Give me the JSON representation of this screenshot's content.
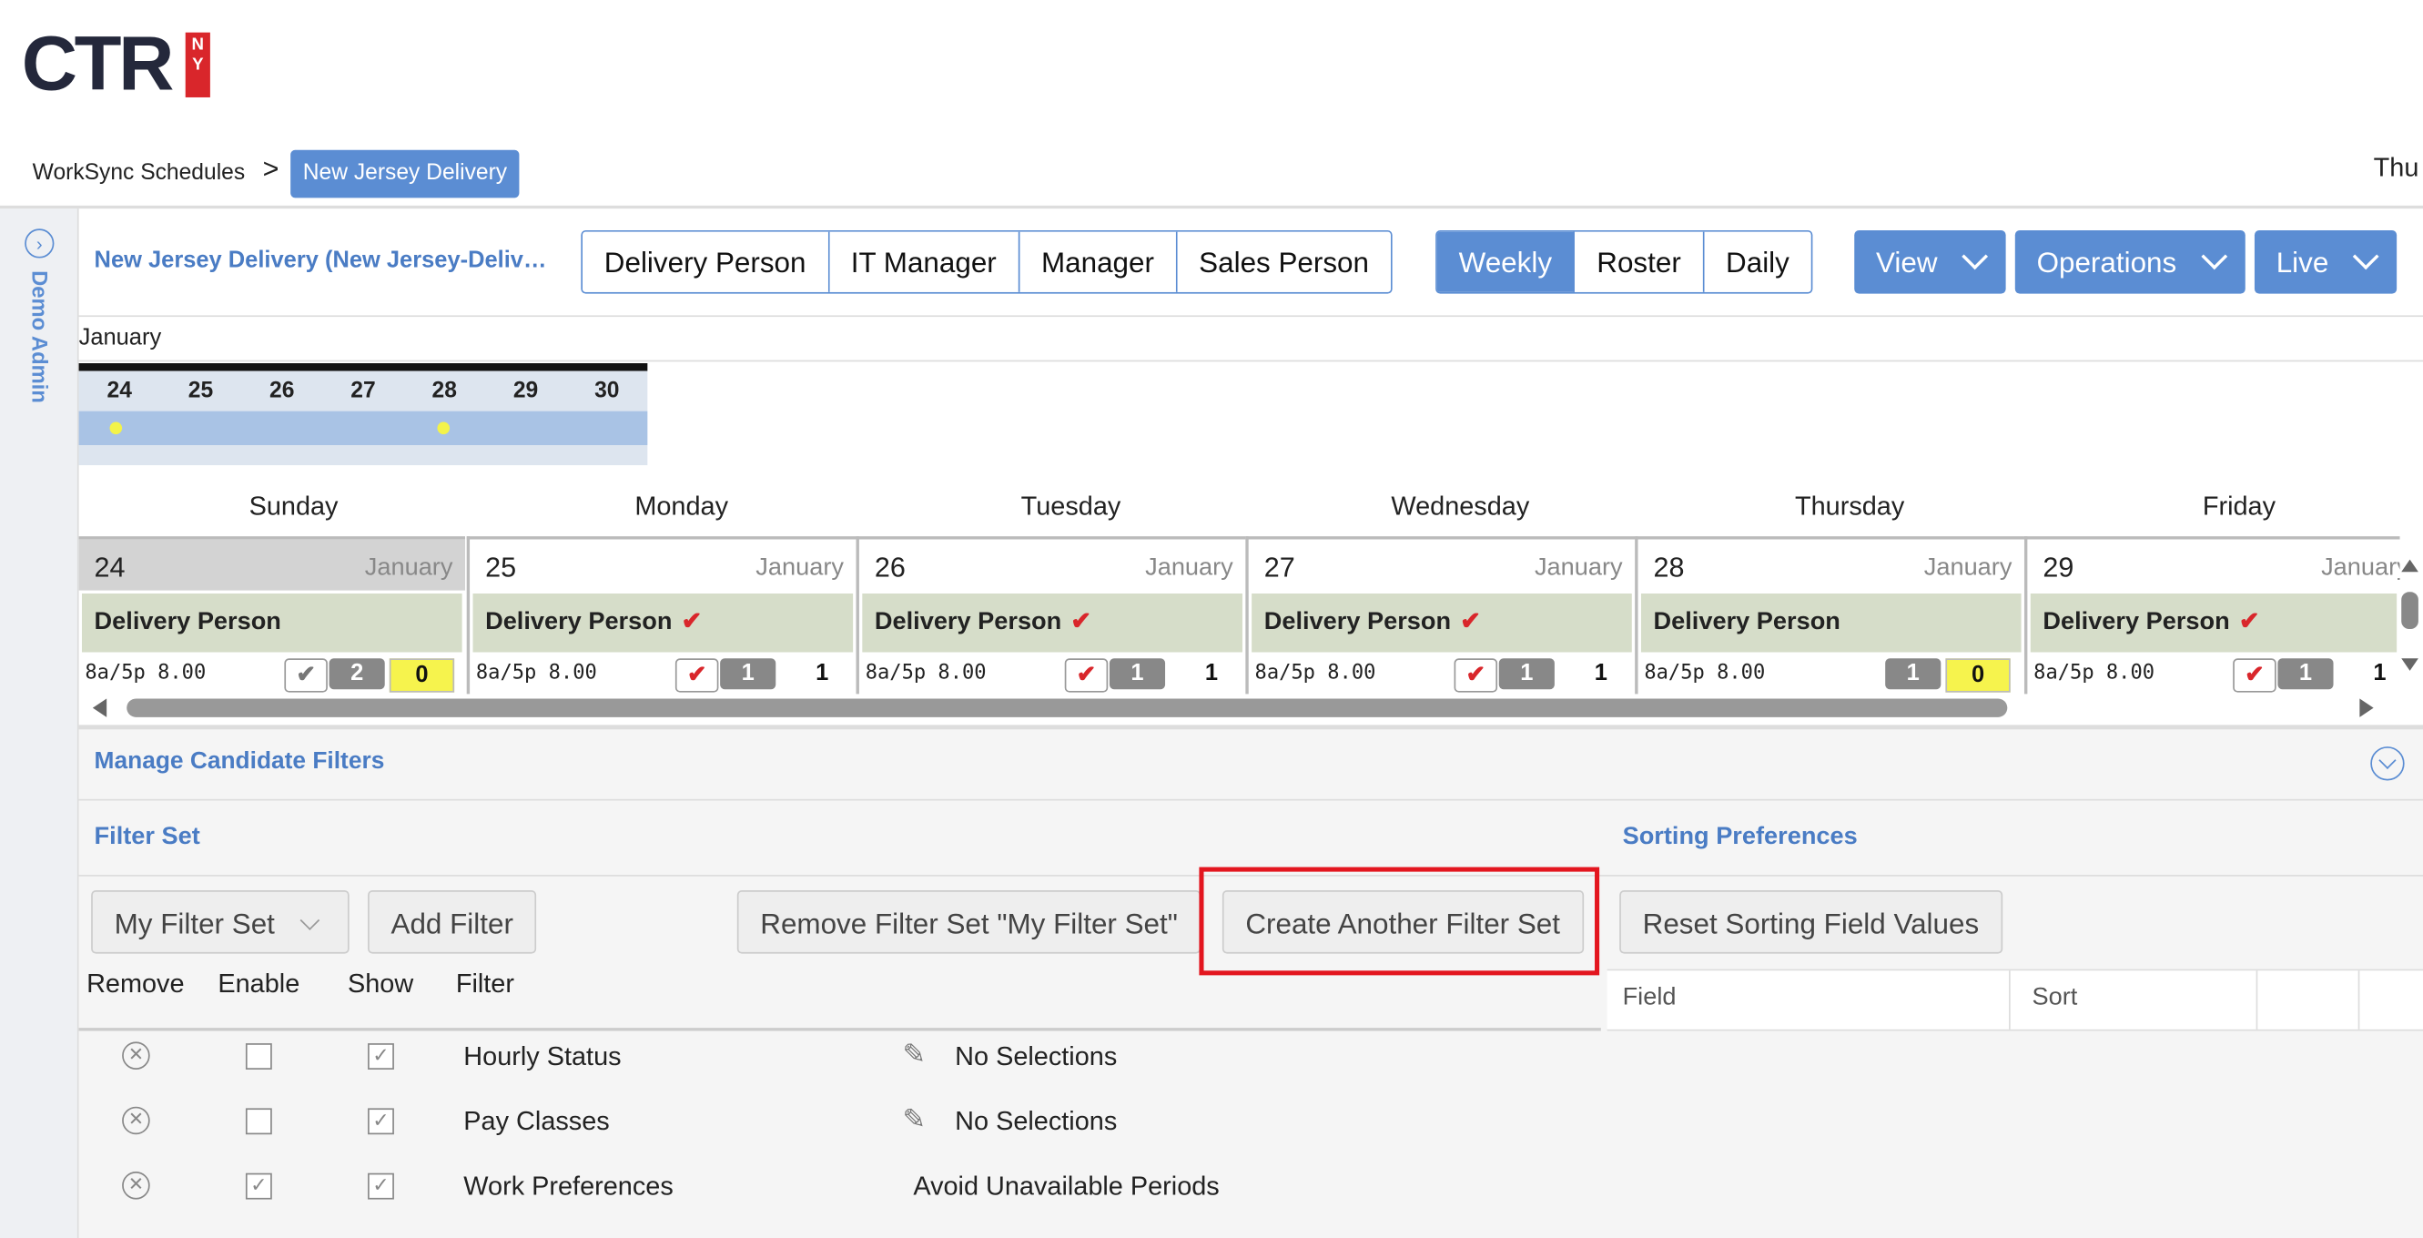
{
  "logo": {
    "text": "CTR",
    "badge": "NY"
  },
  "breadcrumb": {
    "root": "WorkSync Schedules",
    "separator": ">",
    "current": "New Jersey Delivery"
  },
  "header_date": "Thu",
  "sidebar": {
    "user": "Demo Admin"
  },
  "schedule_title": "New Jersey Delivery (New Jersey-Deliv…",
  "positions": [
    "Delivery Person",
    "IT Manager",
    "Manager",
    "Sales Person"
  ],
  "views": [
    {
      "label": "Weekly",
      "selected": true
    },
    {
      "label": "Roster",
      "selected": false
    },
    {
      "label": "Daily",
      "selected": false
    }
  ],
  "menus": [
    "View",
    "Operations",
    "Live"
  ],
  "mini_calendar": {
    "month": "January",
    "days": [
      "24",
      "25",
      "26",
      "27",
      "28",
      "29",
      "30"
    ],
    "marked_days": [
      "24",
      "28"
    ]
  },
  "week": [
    {
      "dayname": "Sunday",
      "num": "24",
      "month": "January",
      "role": "Delivery Person",
      "checked": false,
      "time": "8a/5p 8.00",
      "today": true
    },
    {
      "dayname": "Monday",
      "num": "25",
      "month": "January",
      "role": "Delivery Person",
      "checked": true,
      "time": "8a/5p 8.00"
    },
    {
      "dayname": "Tuesday",
      "num": "26",
      "month": "January",
      "role": "Delivery Person",
      "checked": true,
      "time": "8a/5p 8.00"
    },
    {
      "dayname": "Wednesday",
      "num": "27",
      "month": "January",
      "role": "Delivery Person",
      "checked": true,
      "time": "8a/5p 8.00"
    },
    {
      "dayname": "Thursday",
      "num": "28",
      "month": "January",
      "role": "Delivery Person",
      "checked": false,
      "time": "8a/5p 8.00"
    },
    {
      "dayname": "Friday",
      "num": "29",
      "month": "January",
      "role": "Delivery Person",
      "checked": true,
      "time": "8a/5p 8.00"
    }
  ],
  "shift_counts": {
    "sun": {
      "a": "2",
      "b": "0"
    },
    "mon": {
      "a": "1",
      "b": "1"
    },
    "tue": {
      "a": "1",
      "b": "1"
    },
    "wed": {
      "a": "1",
      "b": "1"
    },
    "thu": {
      "a": "1",
      "b": "0"
    },
    "fri": {
      "a": "1",
      "b": "1"
    }
  },
  "filters": {
    "section_title": "Manage Candidate Filters",
    "filter_set_title": "Filter Set",
    "sorting_title": "Sorting Preferences",
    "filter_set_select": "My Filter Set",
    "add_filter": "Add Filter",
    "remove_set": "Remove Filter Set \"My Filter Set\"",
    "create_set": "Create Another Filter Set",
    "reset_sorting": "Reset Sorting Field Values",
    "columns": [
      "Remove",
      "Enable",
      "Show",
      "Filter"
    ],
    "sort_columns": [
      "Field",
      "Sort"
    ],
    "rows": [
      {
        "name": "Hourly Status",
        "enabled": false,
        "show": true,
        "value": "No Selections",
        "editable": true
      },
      {
        "name": "Pay Classes",
        "enabled": false,
        "show": true,
        "value": "No Selections",
        "editable": true
      },
      {
        "name": "Work Preferences",
        "enabled": true,
        "show": true,
        "value": "Avoid Unavailable Periods",
        "editable": false
      }
    ]
  }
}
